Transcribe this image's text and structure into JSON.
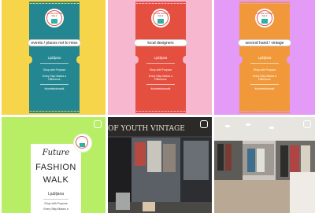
{
  "posts": [
    {
      "bg": "#f7d54a",
      "ticket": "#238690",
      "pill": "events / places not to miss",
      "city": "Ljubljana",
      "line1": "Shop with Purpose",
      "line2": "Every Step Makes a Difference",
      "line3": "futurefashionwalk"
    },
    {
      "bg": "#f7b8cf",
      "ticket": "#e54f3f",
      "pill": "local designers",
      "city": "Ljubljana",
      "line1": "Shop with Purpose",
      "line2": "Every Step Makes a Difference",
      "line3": "futurefashionwalk"
    },
    {
      "bg": "#e49af7",
      "ticket": "#f1993a",
      "pill": "second hand / vintage",
      "city": "Ljubljana",
      "line1": "Shop with Purpose",
      "line2": "Every Step Makes a Difference",
      "line3": "futurefashionwalk"
    }
  ],
  "badge_text": "FUTURE FASHION WALK",
  "post4": {
    "bg": "#b7ee66",
    "script": "Future",
    "line1": "FASHION",
    "line2": "WALK",
    "city": "Ljubljana",
    "sub1": "Shop with Purpose",
    "sub2": "Every Step Makes a"
  },
  "post5": {
    "sign": "OF YOUTH VINTAGE"
  },
  "icons": {
    "multi": "carousel-icon"
  }
}
